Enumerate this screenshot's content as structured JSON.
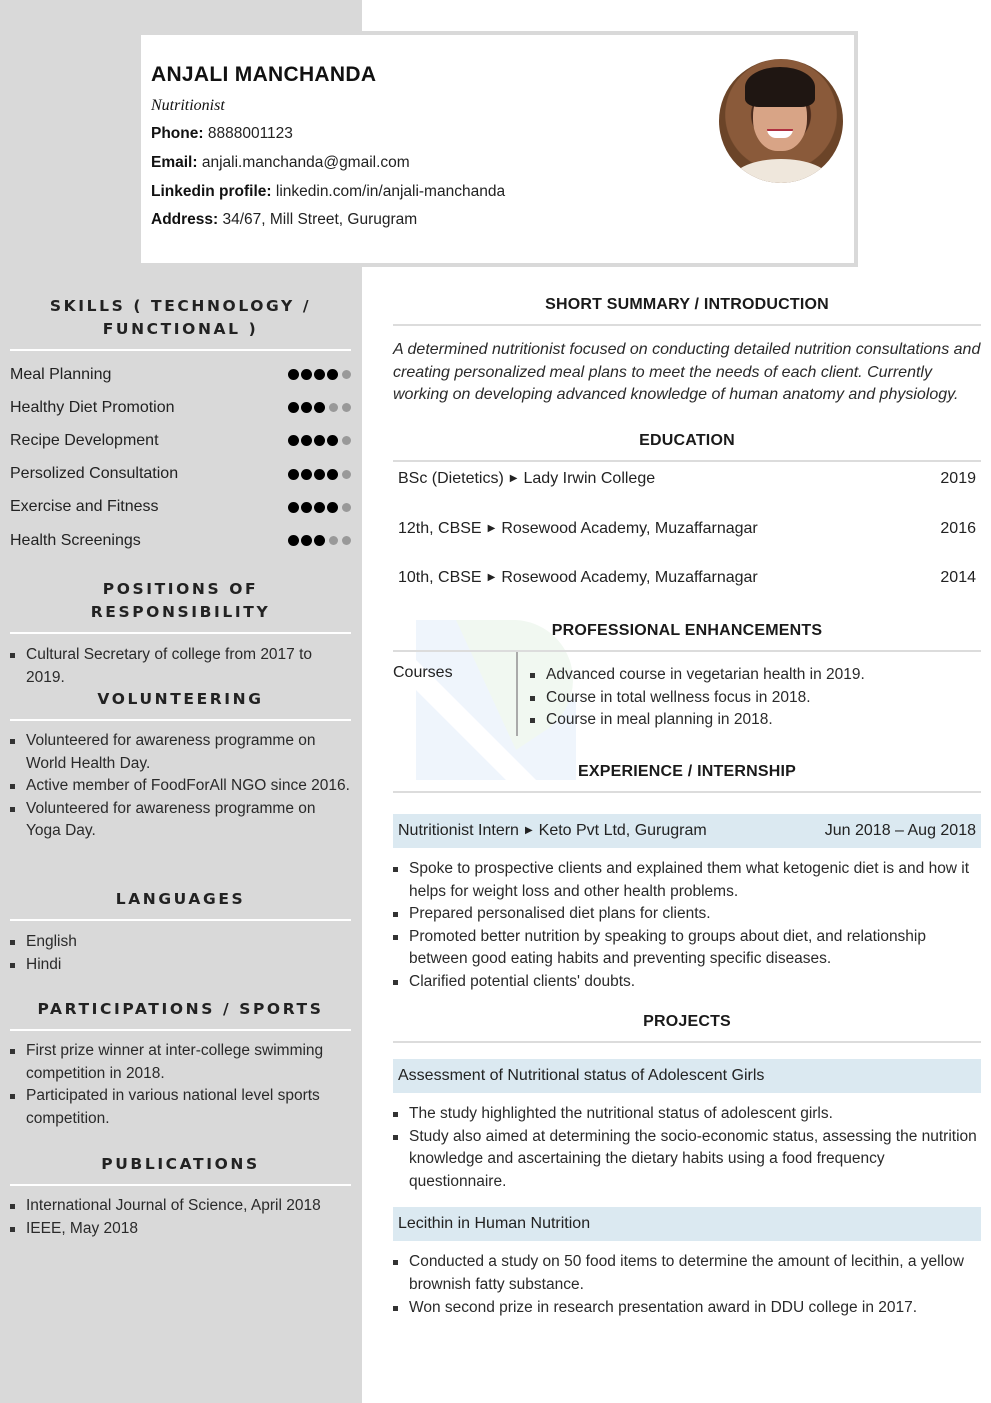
{
  "header": {
    "name": "ANJALI MANCHANDA",
    "title": "Nutritionist",
    "contact": [
      {
        "label": "Phone:",
        "value": "8888001123"
      },
      {
        "label": "Email:",
        "value": "anjali.manchanda@gmail.com"
      },
      {
        "label": "Linkedin profile:",
        "value": "linkedin.com/in/anjali-manchanda"
      },
      {
        "label": "Address:",
        "value": "34/67, Mill Street, Gurugram"
      }
    ]
  },
  "sidebar": {
    "skills": {
      "heading_line1": "SKILLS ( TECHNOLOGY /",
      "heading_line2": "FUNCTIONAL )",
      "max_rating": 5,
      "items": [
        {
          "name": "Meal Planning",
          "rating": 4
        },
        {
          "name": "Healthy Diet Promotion",
          "rating": 3
        },
        {
          "name": "Recipe Development",
          "rating": 4
        },
        {
          "name": "Persolized Consultation",
          "rating": 4
        },
        {
          "name": "Exercise and Fitness",
          "rating": 4
        },
        {
          "name": "Health Screenings",
          "rating": 3
        }
      ]
    },
    "positions": {
      "heading": "POSITIONS OF RESPONSIBILITY",
      "items": [
        "Cultural Secretary of college from 2017 to 2019."
      ]
    },
    "volunteering": {
      "heading": "VOLUNTEERING",
      "items": [
        "Volunteered for awareness programme on World Health Day.",
        "Active member of FoodForAll NGO since 2016.",
        "Volunteered for awareness programme on Yoga Day."
      ]
    },
    "languages": {
      "heading": "LANGUAGES",
      "items": [
        "English",
        "Hindi"
      ]
    },
    "participations": {
      "heading": "PARTICIPATIONS / SPORTS",
      "items": [
        "First prize winner at inter-college swimming competition in 2018.",
        "Participated in various national level sports competition."
      ]
    },
    "publications": {
      "heading": "PUBLICATIONS",
      "items": [
        "International Journal of Science, April 2018",
        "IEEE, May 2018"
      ]
    }
  },
  "main": {
    "summary": {
      "heading": "SHORT SUMMARY / INTRODUCTION",
      "text": "A determined nutritionist focused on conducting detailed nutrition consultations and creating personalized meal plans to meet the needs of each client. Currently working on developing advanced knowledge of human anatomy and physiology."
    },
    "education": {
      "heading": "EDUCATION",
      "items": [
        {
          "degree": "BSc (Dietetics)",
          "institution": "Lady Irwin College",
          "year": "2019"
        },
        {
          "degree": "12th, CBSE",
          "institution": "Rosewood Academy, Muzaffarnagar",
          "year": "2016"
        },
        {
          "degree": "10th, CBSE",
          "institution": "Rosewood Academy, Muzaffarnagar",
          "year": "2014"
        }
      ]
    },
    "enhancements": {
      "heading": "PROFESSIONAL ENHANCEMENTS",
      "label": "Courses",
      "items": [
        "Advanced course in vegetarian health in 2019.",
        "Course in total wellness focus in 2018.",
        "Course in meal planning in 2018."
      ]
    },
    "experience": {
      "heading": "EXPERIENCE / INTERNSHIP",
      "role": "Nutritionist Intern",
      "company": "Keto Pvt Ltd, Gurugram",
      "dates": "Jun 2018 – Aug 2018",
      "items": [
        "Spoke to prospective clients and explained them what ketogenic diet is and how it helps for weight loss and other health problems.",
        "Prepared personalised diet plans for clients.",
        "Promoted better nutrition by speaking to groups about diet, and relationship between good eating habits and preventing specific diseases.",
        "Clarified potential clients' doubts."
      ]
    },
    "projects": {
      "heading": "PROJECTS",
      "items": [
        {
          "title": "Assessment of Nutritional status of Adolescent Girls",
          "points": [
            "The study highlighted the nutritional status of adolescent girls.",
            "Study also aimed at determining the socio-economic status, assessing the nutrition knowledge and ascertaining the dietary habits using a food frequency questionnaire."
          ]
        },
        {
          "title": "Lecithin in Human Nutrition",
          "points": [
            "Conducted a study on 50 food items to determine the amount of lecithin, a yellow brownish fatty substance.",
            "Won second prize in research presentation award in DDU college in 2017."
          ]
        }
      ]
    }
  },
  "colors": {
    "sidebar_bg": "#d9d9d9",
    "highlight_bar": "#dbe9f1",
    "dot_on": "#000000",
    "dot_off": "#999999"
  },
  "icons": {
    "arrow": "arrow-right-icon",
    "bullet": "square-bullet-icon",
    "rating_dot": "rating-dot-icon"
  }
}
